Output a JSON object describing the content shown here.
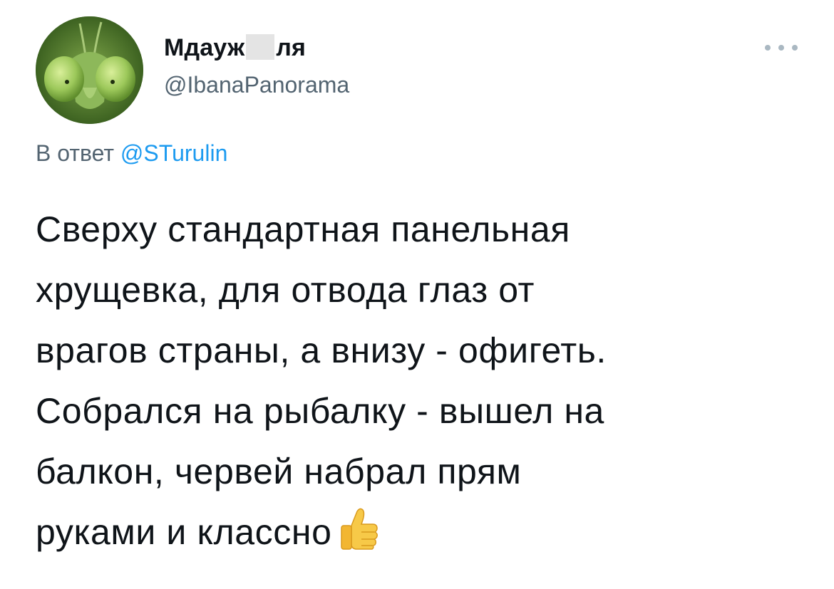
{
  "author": {
    "display_name_visible_start": "Мдауж",
    "display_name_visible_end": "ля",
    "handle": "@IbanaPanorama",
    "avatar_icon": "praying-mantis-avatar"
  },
  "more_icon": "more-horizontal-icon",
  "reply": {
    "prefix": "В ответ",
    "mention": "@STurulin"
  },
  "tweet": {
    "lines": [
      "Сверху стандартная панельная",
      "хрущевка, для отвода глаз от",
      "врагов страны, а внизу - офигеть.",
      "Собрался на рыбалку - вышел на",
      "балкон, червей набрал прям",
      "руками и классно"
    ],
    "emoji": "thumbs-up-emoji"
  },
  "colors": {
    "secondary_text": "#536471",
    "link": "#1d9bf0",
    "primary_text": "#0f1419"
  }
}
